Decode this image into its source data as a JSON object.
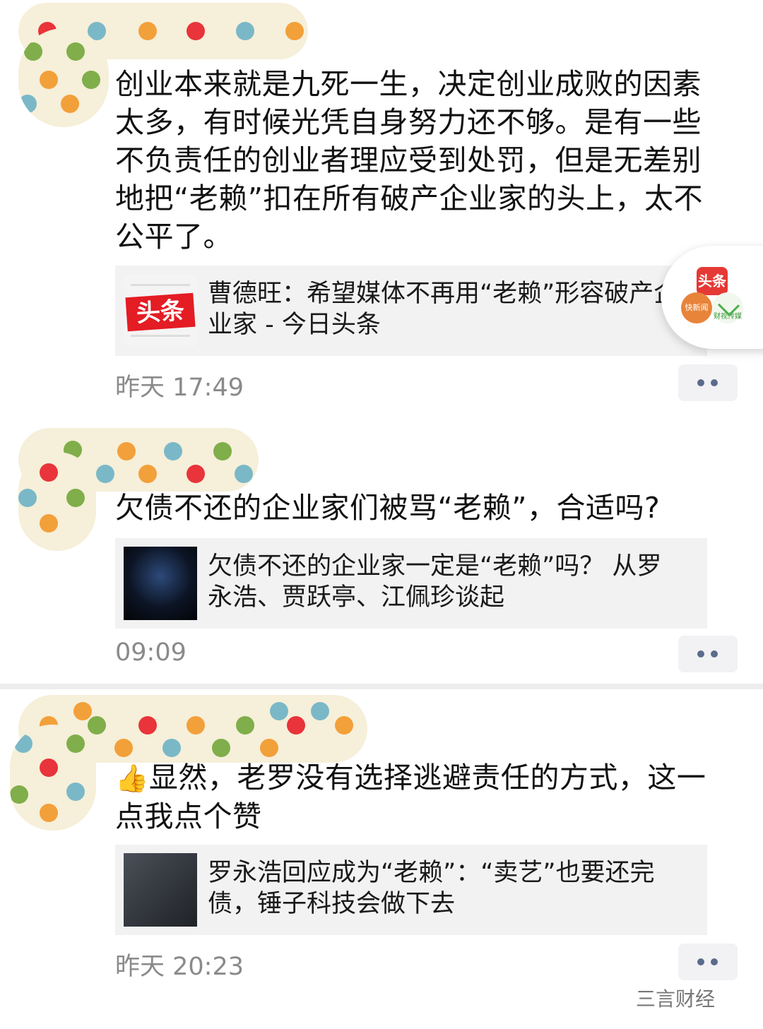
{
  "posts": [
    {
      "text": "创业本来就是九死一生，决定创业成败的因素太多，有时候光凭自身努力还不够。是有一些不负责任的创业者理应受到处罚，但是无差别地把“老赖”扣在所有破产企业家的头上，太不公平了。",
      "link_title": "曹德旺：希望媒体不再用“老赖”形容破产企业家 - 今日头条",
      "thumb_text": "头条",
      "time": "昨天 17:49"
    },
    {
      "text": "欠债不还的企业家们被骂“老赖”，合适吗?",
      "link_title": "欠债不还的企业家一定是“老赖”吗？ 从罗永浩、贾跃亭、江佩珍谈起",
      "time": "09:09"
    },
    {
      "emoji": "👍",
      "text": "显然，老罗没有选择逃避责任的方式，这一点我点个赞",
      "link_title": "罗永浩回应成为“老赖”：“卖艺”也要还完债，锤子科技会做下去",
      "time": "昨天 20:23"
    }
  ],
  "float_button": {
    "labels": [
      "头条",
      "快新闻",
      "财视传媒"
    ]
  },
  "watermark": "三言财经",
  "colors": {
    "dot_red": "#e8343a",
    "dot_green": "#7fae4a",
    "dot_orange": "#f2a03a",
    "dot_teal": "#7ab8c8",
    "mask_bg": "#f6efd9",
    "link_bg": "#f2f2f2",
    "more_dots": "#5b6b8c"
  }
}
